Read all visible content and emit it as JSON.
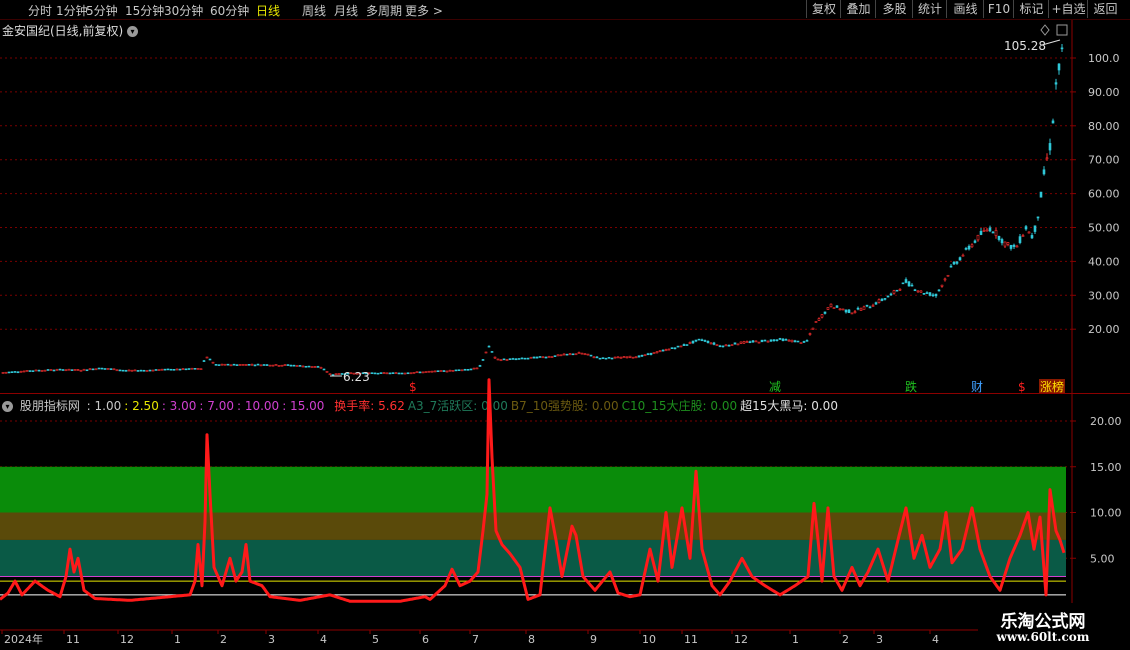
{
  "toolbar": {
    "periods": [
      "分时",
      "1分钟",
      "5分钟",
      "15分钟",
      "30分钟",
      "60分钟",
      "日线",
      "周线",
      "月线",
      "多周期",
      "更多 >"
    ],
    "active_period": "日线",
    "right_buttons": [
      "复权",
      "叠加",
      "多股",
      "统计",
      "画线",
      "F10",
      "标记",
      "+自选",
      "返回"
    ]
  },
  "price_panel": {
    "title": "金安国纪(日线,前复权)",
    "high_label": "105.28",
    "low_label": "6.23",
    "y_ticks": [
      "100.0",
      "90.00",
      "80.00",
      "70.00",
      "60.00",
      "50.00",
      "40.00",
      "30.00",
      "20.00"
    ],
    "events": [
      {
        "label": "$",
        "color": "#ff2020"
      },
      {
        "label": "减",
        "color": "#20c020"
      },
      {
        "label": "跌",
        "color": "#20c020"
      },
      {
        "label": "财",
        "color": "#40a0ff"
      },
      {
        "label": "$",
        "color": "#ff2020"
      },
      {
        "label": "涨榜",
        "color": "#ffe000"
      }
    ]
  },
  "indicator_panel": {
    "name": "股朋指标网",
    "params": [
      {
        "text": ": 1.00",
        "color": "#c8c8c8"
      },
      {
        "text": ": 2.50",
        "color": "#e8e800"
      },
      {
        "text": ": 3.00",
        "color": "#d040d0"
      },
      {
        "text": ": 7.00",
        "color": "#d040d0"
      },
      {
        "text": ": 10.00",
        "color": "#d040d0"
      },
      {
        "text": ": 15.00",
        "color": "#d040d0"
      }
    ],
    "series_labels": [
      {
        "text": "换手率: 5.62",
        "color": "#ff3030"
      },
      {
        "text": "A3_7活跃区: 0.00",
        "color": "#1f7a5a"
      },
      {
        "text": "B7_10强势股: 0.00",
        "color": "#6b5a10"
      },
      {
        "text": "C10_15大庄股: 0.00",
        "color": "#1e8f1e"
      },
      {
        "text": "超15大黑马: 0.00",
        "color": "#e0e0e0"
      }
    ],
    "y_ticks": [
      "20.00",
      "15.00",
      "10.00",
      "5.00"
    ],
    "zone_colors": {
      "a3_7": "#0a5a46",
      "b7_10": "#5a4a0a",
      "c10_15": "#0a8c0a"
    }
  },
  "date_axis": {
    "labels": [
      "2024年",
      "11",
      "12",
      "1",
      "2",
      "3",
      "4",
      "5",
      "6",
      "7",
      "8",
      "9",
      "10",
      "11",
      "12",
      "1",
      "2",
      "3",
      "4"
    ]
  },
  "watermark": {
    "line1": "乐淘公式网",
    "line2": "www.60lt.com"
  },
  "chart_data": {
    "type": "candlestick",
    "price_ylim": [
      0,
      110
    ],
    "price_anchors": [
      [
        0,
        7.2
      ],
      [
        30,
        7.8
      ],
      [
        60,
        8.1
      ],
      [
        80,
        8.0
      ],
      [
        100,
        8.5
      ],
      [
        110,
        8.3
      ],
      [
        125,
        7.8
      ],
      [
        150,
        7.9
      ],
      [
        170,
        8.2
      ],
      [
        200,
        8.4
      ],
      [
        205,
        12.0
      ],
      [
        215,
        9.5
      ],
      [
        250,
        9.6
      ],
      [
        290,
        9.4
      ],
      [
        320,
        8.8
      ],
      [
        330,
        6.6
      ],
      [
        345,
        7.0
      ],
      [
        400,
        7.1
      ],
      [
        450,
        7.8
      ],
      [
        478,
        8.5
      ],
      [
        488,
        15.0
      ],
      [
        495,
        11.0
      ],
      [
        520,
        11.3
      ],
      [
        550,
        12.0
      ],
      [
        580,
        13.0
      ],
      [
        600,
        11.4
      ],
      [
        640,
        12.0
      ],
      [
        680,
        15.0
      ],
      [
        700,
        17.0
      ],
      [
        720,
        15.0
      ],
      [
        740,
        16.0
      ],
      [
        780,
        17.0
      ],
      [
        805,
        16.0
      ],
      [
        815,
        22.0
      ],
      [
        830,
        27.0
      ],
      [
        850,
        25.0
      ],
      [
        870,
        27.0
      ],
      [
        890,
        30.0
      ],
      [
        905,
        34.0
      ],
      [
        920,
        31.0
      ],
      [
        935,
        30.0
      ],
      [
        950,
        38.0
      ],
      [
        965,
        43.0
      ],
      [
        980,
        48.0
      ],
      [
        990,
        50.0
      ],
      [
        1005,
        45.0
      ],
      [
        1015,
        44.0
      ],
      [
        1025,
        50.0
      ],
      [
        1032,
        47.0
      ],
      [
        1038,
        55.0
      ],
      [
        1044,
        68.0
      ],
      [
        1050,
        75.0
      ],
      [
        1055,
        92.0
      ],
      [
        1060,
        100.0
      ],
      [
        1063,
        104.0
      ]
    ],
    "turnover_ylim": [
      0,
      25
    ],
    "turnover_anchors": [
      [
        0,
        0.5
      ],
      [
        8,
        1.2
      ],
      [
        15,
        2.5
      ],
      [
        22,
        1.0
      ],
      [
        35,
        2.5
      ],
      [
        48,
        1.5
      ],
      [
        60,
        0.8
      ],
      [
        66,
        3.0
      ],
      [
        70,
        6.0
      ],
      [
        74,
        3.5
      ],
      [
        78,
        5.0
      ],
      [
        84,
        1.5
      ],
      [
        95,
        0.6
      ],
      [
        130,
        0.4
      ],
      [
        170,
        0.8
      ],
      [
        190,
        1.0
      ],
      [
        195,
        2.5
      ],
      [
        198,
        6.5
      ],
      [
        202,
        2.0
      ],
      [
        205,
        9.0
      ],
      [
        207,
        18.5
      ],
      [
        210,
        12.0
      ],
      [
        214,
        4.0
      ],
      [
        222,
        2.0
      ],
      [
        230,
        5.0
      ],
      [
        236,
        2.5
      ],
      [
        242,
        3.5
      ],
      [
        246,
        6.5
      ],
      [
        250,
        2.5
      ],
      [
        262,
        2.0
      ],
      [
        270,
        0.8
      ],
      [
        300,
        0.4
      ],
      [
        330,
        1.0
      ],
      [
        350,
        0.3
      ],
      [
        400,
        0.3
      ],
      [
        425,
        0.8
      ],
      [
        430,
        0.5
      ],
      [
        445,
        2.0
      ],
      [
        452,
        3.8
      ],
      [
        460,
        2.0
      ],
      [
        470,
        2.5
      ],
      [
        478,
        3.5
      ],
      [
        483,
        8.0
      ],
      [
        487,
        12.0
      ],
      [
        489,
        24.5
      ],
      [
        492,
        16.0
      ],
      [
        496,
        8.0
      ],
      [
        502,
        6.5
      ],
      [
        510,
        5.5
      ],
      [
        520,
        4.0
      ],
      [
        528,
        0.5
      ],
      [
        540,
        1.0
      ],
      [
        550,
        10.5
      ],
      [
        556,
        7.0
      ],
      [
        562,
        3.0
      ],
      [
        572,
        8.5
      ],
      [
        576,
        7.5
      ],
      [
        583,
        3.0
      ],
      [
        595,
        1.5
      ],
      [
        610,
        3.5
      ],
      [
        618,
        1.2
      ],
      [
        630,
        0.8
      ],
      [
        640,
        1.0
      ],
      [
        650,
        6.0
      ],
      [
        658,
        2.5
      ],
      [
        666,
        10.0
      ],
      [
        672,
        4.0
      ],
      [
        682,
        10.5
      ],
      [
        690,
        5.0
      ],
      [
        696,
        14.5
      ],
      [
        702,
        6.0
      ],
      [
        712,
        2.0
      ],
      [
        720,
        1.0
      ],
      [
        730,
        2.5
      ],
      [
        742,
        5.0
      ],
      [
        752,
        3.0
      ],
      [
        765,
        2.0
      ],
      [
        780,
        1.0
      ],
      [
        795,
        2.0
      ],
      [
        808,
        3.0
      ],
      [
        814,
        11.0
      ],
      [
        818,
        7.0
      ],
      [
        822,
        2.5
      ],
      [
        828,
        10.5
      ],
      [
        834,
        3.0
      ],
      [
        842,
        1.5
      ],
      [
        852,
        4.0
      ],
      [
        860,
        2.0
      ],
      [
        868,
        3.5
      ],
      [
        878,
        6.0
      ],
      [
        888,
        2.5
      ],
      [
        898,
        7.0
      ],
      [
        906,
        10.5
      ],
      [
        914,
        5.0
      ],
      [
        922,
        7.5
      ],
      [
        930,
        4.0
      ],
      [
        940,
        6.0
      ],
      [
        946,
        10.0
      ],
      [
        952,
        4.5
      ],
      [
        962,
        6.0
      ],
      [
        972,
        10.5
      ],
      [
        980,
        6.0
      ],
      [
        990,
        3.0
      ],
      [
        1000,
        1.5
      ],
      [
        1010,
        5.0
      ],
      [
        1020,
        7.5
      ],
      [
        1028,
        10.0
      ],
      [
        1034,
        6.0
      ],
      [
        1040,
        9.5
      ],
      [
        1046,
        1.0
      ],
      [
        1050,
        12.5
      ],
      [
        1056,
        8.0
      ],
      [
        1060,
        7.0
      ],
      [
        1064,
        5.6
      ]
    ]
  }
}
